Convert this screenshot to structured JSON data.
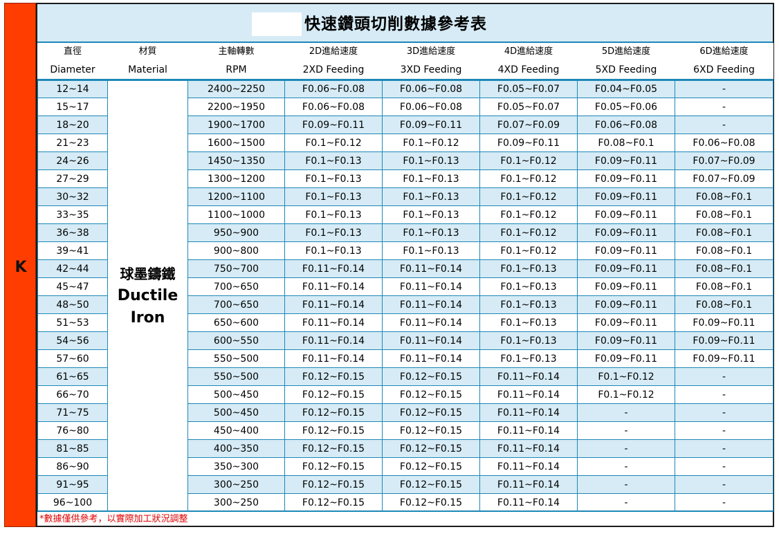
{
  "sidebar": {
    "letter": "K"
  },
  "title": "快速鑽頭切削數據參考表",
  "headers": [
    {
      "zh": "直徑",
      "en": "Diameter"
    },
    {
      "zh": "材質",
      "en": "Material"
    },
    {
      "zh": "主軸轉數",
      "en": "RPM"
    },
    {
      "zh": "2D進給速度",
      "en": "2XD Feeding"
    },
    {
      "zh": "3D進給速度",
      "en": "3XD Feeding"
    },
    {
      "zh": "4D進給速度",
      "en": "4XD Feeding"
    },
    {
      "zh": "5D進給速度",
      "en": "5XD Feeding"
    },
    {
      "zh": "6D進給速度",
      "en": "6XD Feeding"
    }
  ],
  "material": {
    "zh": "球墨鑄鐵",
    "en_line1": "Ductile",
    "en_line2": "Iron"
  },
  "rows": [
    [
      "12~14",
      "2400~2250",
      "F0.06~F0.08",
      "F0.06~F0.08",
      "F0.05~F0.07",
      "F0.04~F0.05",
      "-"
    ],
    [
      "15~17",
      "2200~1950",
      "F0.06~F0.08",
      "F0.06~F0.08",
      "F0.05~F0.07",
      "F0.05~F0.06",
      "-"
    ],
    [
      "18~20",
      "1900~1700",
      "F0.09~F0.11",
      "F0.09~F0.11",
      "F0.07~F0.09",
      "F0.06~F0.08",
      "-"
    ],
    [
      "21~23",
      "1600~1500",
      "F0.1~F0.12",
      "F0.1~F0.12",
      "F0.09~F0.11",
      "F0.08~F0.1",
      "F0.06~F0.08"
    ],
    [
      "24~26",
      "1450~1350",
      "F0.1~F0.13",
      "F0.1~F0.13",
      "F0.1~F0.12",
      "F0.09~F0.11",
      "F0.07~F0.09"
    ],
    [
      "27~29",
      "1300~1200",
      "F0.1~F0.13",
      "F0.1~F0.13",
      "F0.1~F0.12",
      "F0.09~F0.11",
      "F0.07~F0.09"
    ],
    [
      "30~32",
      "1200~1100",
      "F0.1~F0.13",
      "F0.1~F0.13",
      "F0.1~F0.12",
      "F0.09~F0.11",
      "F0.08~F0.1"
    ],
    [
      "33~35",
      "1100~1000",
      "F0.1~F0.13",
      "F0.1~F0.13",
      "F0.1~F0.12",
      "F0.09~F0.11",
      "F0.08~F0.1"
    ],
    [
      "36~38",
      "950~900",
      "F0.1~F0.13",
      "F0.1~F0.13",
      "F0.1~F0.12",
      "F0.09~F0.11",
      "F0.08~F0.1"
    ],
    [
      "39~41",
      "900~800",
      "F0.1~F0.13",
      "F0.1~F0.13",
      "F0.1~F0.12",
      "F0.09~F0.11",
      "F0.08~F0.1"
    ],
    [
      "42~44",
      "750~700",
      "F0.11~F0.14",
      "F0.11~F0.14",
      "F0.1~F0.13",
      "F0.09~F0.11",
      "F0.08~F0.1"
    ],
    [
      "45~47",
      "700~650",
      "F0.11~F0.14",
      "F0.11~F0.14",
      "F0.1~F0.13",
      "F0.09~F0.11",
      "F0.08~F0.1"
    ],
    [
      "48~50",
      "700~650",
      "F0.11~F0.14",
      "F0.11~F0.14",
      "F0.1~F0.13",
      "F0.09~F0.11",
      "F0.08~F0.1"
    ],
    [
      "51~53",
      "650~600",
      "F0.11~F0.14",
      "F0.11~F0.14",
      "F0.1~F0.13",
      "F0.09~F0.11",
      "F0.09~F0.11"
    ],
    [
      "54~56",
      "600~550",
      "F0.11~F0.14",
      "F0.11~F0.14",
      "F0.1~F0.13",
      "F0.09~F0.11",
      "F0.09~F0.11"
    ],
    [
      "57~60",
      "550~500",
      "F0.11~F0.14",
      "F0.11~F0.14",
      "F0.1~F0.13",
      "F0.09~F0.11",
      "F0.09~F0.11"
    ],
    [
      "61~65",
      "550~500",
      "F0.12~F0.15",
      "F0.12~F0.15",
      "F0.11~F0.14",
      "F0.1~F0.12",
      "-"
    ],
    [
      "66~70",
      "500~450",
      "F0.12~F0.15",
      "F0.12~F0.15",
      "F0.11~F0.14",
      "F0.1~F0.12",
      "-"
    ],
    [
      "71~75",
      "500~450",
      "F0.12~F0.15",
      "F0.12~F0.15",
      "F0.11~F0.14",
      "-",
      "-"
    ],
    [
      "76~80",
      "450~400",
      "F0.12~F0.15",
      "F0.12~F0.15",
      "F0.11~F0.14",
      "-",
      "-"
    ],
    [
      "81~85",
      "400~350",
      "F0.12~F0.15",
      "F0.12~F0.15",
      "F0.11~F0.14",
      "-",
      "-"
    ],
    [
      "86~90",
      "350~300",
      "F0.12~F0.15",
      "F0.12~F0.15",
      "F0.11~F0.14",
      "-",
      "-"
    ],
    [
      "91~95",
      "300~250",
      "F0.12~F0.15",
      "F0.12~F0.15",
      "F0.11~F0.14",
      "-",
      "-"
    ],
    [
      "96~100",
      "300~250",
      "F0.12~F0.15",
      "F0.12~F0.15",
      "F0.11~F0.14",
      "-",
      "-"
    ]
  ],
  "footnote": "*數據僅供參考，以實際加工狀況調整",
  "colors": {
    "accent_blue": "#1c87b7",
    "stripe": "#d6ebf5",
    "sidebar_red": "#ff3d00",
    "footnote_red": "#e00000"
  }
}
